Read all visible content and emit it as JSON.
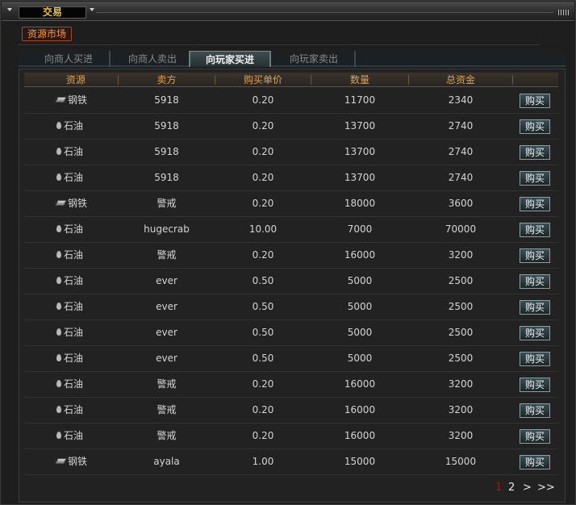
{
  "window": {
    "title": "交易"
  },
  "market_button": "资源市场",
  "tabs": [
    {
      "label": "向商人买进",
      "active": false
    },
    {
      "label": "向商人卖出",
      "active": false
    },
    {
      "label": "向玩家买进",
      "active": true
    },
    {
      "label": "向玩家卖出",
      "active": false
    }
  ],
  "table": {
    "headers": [
      "资源",
      "卖方",
      "购买单价",
      "数量",
      "总资金"
    ],
    "buy_label": "购买",
    "rows": [
      {
        "resource": "钢铁",
        "icon": "steel-icon",
        "seller": "5918",
        "price": "0.20",
        "qty": "11700",
        "total": "2340"
      },
      {
        "resource": "石油",
        "icon": "oil-drop-icon",
        "seller": "5918",
        "price": "0.20",
        "qty": "13700",
        "total": "2740"
      },
      {
        "resource": "石油",
        "icon": "oil-drop-icon",
        "seller": "5918",
        "price": "0.20",
        "qty": "13700",
        "total": "2740"
      },
      {
        "resource": "石油",
        "icon": "oil-drop-icon",
        "seller": "5918",
        "price": "0.20",
        "qty": "13700",
        "total": "2740"
      },
      {
        "resource": "钢铁",
        "icon": "steel-icon",
        "seller": "警戒",
        "price": "0.20",
        "qty": "18000",
        "total": "3600"
      },
      {
        "resource": "石油",
        "icon": "oil-drop-icon",
        "seller": "hugecrab",
        "price": "10.00",
        "qty": "7000",
        "total": "70000"
      },
      {
        "resource": "石油",
        "icon": "oil-drop-icon",
        "seller": "警戒",
        "price": "0.20",
        "qty": "16000",
        "total": "3200"
      },
      {
        "resource": "石油",
        "icon": "oil-drop-icon",
        "seller": "ever",
        "price": "0.50",
        "qty": "5000",
        "total": "2500"
      },
      {
        "resource": "石油",
        "icon": "oil-drop-icon",
        "seller": "ever",
        "price": "0.50",
        "qty": "5000",
        "total": "2500"
      },
      {
        "resource": "石油",
        "icon": "oil-drop-icon",
        "seller": "ever",
        "price": "0.50",
        "qty": "5000",
        "total": "2500"
      },
      {
        "resource": "石油",
        "icon": "oil-drop-icon",
        "seller": "ever",
        "price": "0.50",
        "qty": "5000",
        "total": "2500"
      },
      {
        "resource": "石油",
        "icon": "oil-drop-icon",
        "seller": "警戒",
        "price": "0.20",
        "qty": "16000",
        "total": "3200"
      },
      {
        "resource": "石油",
        "icon": "oil-drop-icon",
        "seller": "警戒",
        "price": "0.20",
        "qty": "16000",
        "total": "3200"
      },
      {
        "resource": "石油",
        "icon": "oil-drop-icon",
        "seller": "警戒",
        "price": "0.20",
        "qty": "16000",
        "total": "3200"
      },
      {
        "resource": "钢铁",
        "icon": "steel-icon",
        "seller": "ayala",
        "price": "1.00",
        "qty": "15000",
        "total": "15000"
      }
    ]
  },
  "pagination": {
    "current": "1",
    "next_page": "2",
    "next": ">",
    "last": ">>"
  },
  "colors": {
    "title_text": "#f0c040",
    "header_text": "#e0a050",
    "market_text": "#f09a50",
    "current_page": "#9a1a1a"
  }
}
